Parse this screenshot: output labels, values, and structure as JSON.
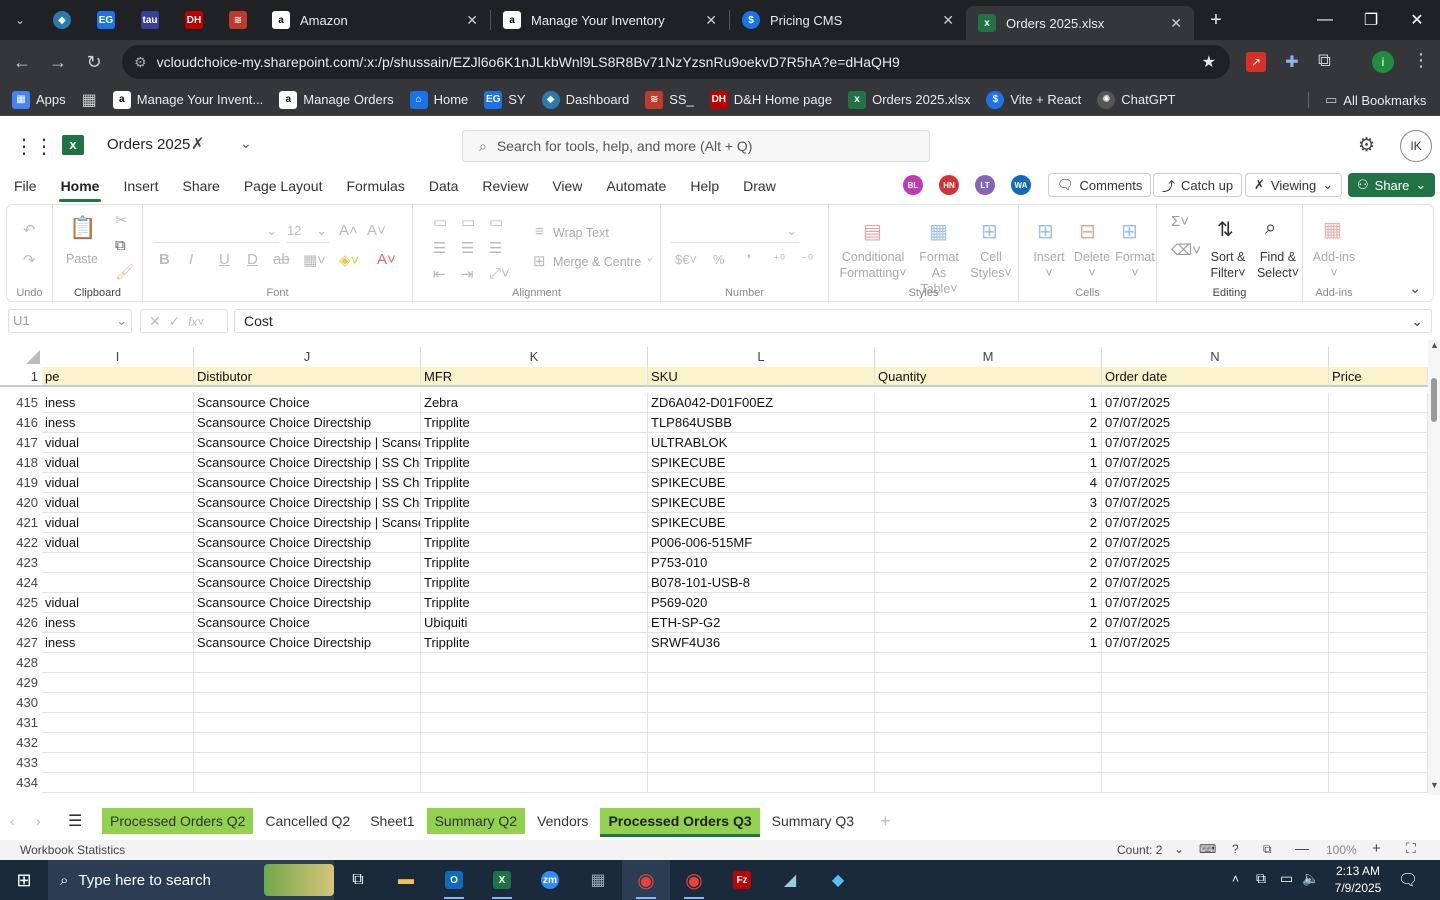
{
  "browser": {
    "tabs": [
      {
        "title": "Amazon",
        "icon": "amazon-icon",
        "active": false
      },
      {
        "title": "Manage Your Inventory",
        "icon": "amazon-icon",
        "active": false
      },
      {
        "title": "Pricing CMS",
        "icon": "dollar-icon",
        "active": false
      },
      {
        "title": "Orders 2025.xlsx",
        "icon": "excel-icon",
        "active": true
      }
    ],
    "pinned_tabs": [
      {
        "label": "EG",
        "color": "#1a73e8"
      },
      {
        "label": "tau",
        "color": "#3b3f9c"
      },
      {
        "label": "DH",
        "color": "#c00000"
      }
    ],
    "new_tab": "+",
    "url": "vcloudchoice-my.sharepoint.com/:x:/p/shussain/EZJl6o6K1nJLkbWnl9LS8R8Bv71NzYzsnRu9oekvD7R5hA?e=dHaQH9",
    "bookmarks": [
      {
        "label": "Apps"
      },
      {
        "label": "Manage Your Invent..."
      },
      {
        "label": "Manage Orders"
      },
      {
        "label": "Home"
      },
      {
        "label": "SY"
      },
      {
        "label": "Dashboard"
      },
      {
        "label": "SS_"
      },
      {
        "label": "D&H Home page"
      },
      {
        "label": "Orders 2025.xlsx"
      },
      {
        "label": "Vite + React"
      },
      {
        "label": "ChatGPT"
      }
    ],
    "all_bookmarks": "All Bookmarks",
    "profile_initial": "i"
  },
  "excel": {
    "doc_title": "Orders 2025",
    "search_placeholder": "Search for tools, help, and more (Alt + Q)",
    "user_initials": "IK",
    "menu": [
      "File",
      "Home",
      "Insert",
      "Share",
      "Page Layout",
      "Formulas",
      "Data",
      "Review",
      "View",
      "Automate",
      "Help",
      "Draw"
    ],
    "collaborators": [
      {
        "initials": "BL",
        "color": "#c239b3"
      },
      {
        "initials": "HN",
        "color": "#d13438"
      },
      {
        "initials": "LT",
        "color": "#8764b8"
      },
      {
        "initials": "WA",
        "color": "#0f6cbd"
      }
    ],
    "comments_label": "Comments",
    "catchup_label": "Catch up",
    "viewing_label": "Viewing",
    "share_label": "Share",
    "ribbon": {
      "undo_group": "Undo",
      "clipboard_group": "Clipboard",
      "paste": "Paste",
      "font_group": "Font",
      "font_size": "12",
      "alignment_group": "Alignment",
      "wrap_text": "Wrap Text",
      "merge_centre": "Merge & Centre",
      "number_group": "Number",
      "styles_group": "Styles",
      "conditional_formatting": [
        "Conditional",
        "Formatting"
      ],
      "format_as_table": [
        "Format As",
        "Table"
      ],
      "cell_styles": [
        "Cell",
        "Styles"
      ],
      "cells_group": "Cells",
      "insert": "Insert",
      "delete": "Delete",
      "format": "Format",
      "editing_group": "Editing",
      "sort_filter": [
        "Sort &",
        "Filter"
      ],
      "find_select": [
        "Find &",
        "Select"
      ],
      "addins_group": "Add-ins",
      "addins": "Add-ins"
    },
    "name_box": "U1",
    "formula": "Cost",
    "columns": [
      {
        "letter": "I",
        "header": "pe"
      },
      {
        "letter": "J",
        "header": "Distibutor"
      },
      {
        "letter": "K",
        "header": "MFR"
      },
      {
        "letter": "L",
        "header": "SKU"
      },
      {
        "letter": "M",
        "header": "Quantity"
      },
      {
        "letter": "N",
        "header": "Order date"
      },
      {
        "letter": "",
        "header": "Price"
      }
    ],
    "header_row_number": "1",
    "rows": [
      {
        "n": "415",
        "i": "iness",
        "j": "Scansource Choice",
        "k": "Zebra",
        "l": "ZD6A042-D01F00EZ",
        "m": "1",
        "date": "07/07/2025"
      },
      {
        "n": "416",
        "i": "iness",
        "j": "Scansource Choice Directship",
        "k": "Tripplite",
        "l": "TLP864USBB",
        "m": "2",
        "date": "07/07/2025"
      },
      {
        "n": "417",
        "i": "vidual",
        "j": "Scansource Choice Directship | Scansource",
        "k": "Tripplite",
        "l": "ULTRABLOK",
        "m": "1",
        "date": "07/07/2025"
      },
      {
        "n": "418",
        "i": "vidual",
        "j": "Scansource Choice Directship | SS Choice",
        "k": "Tripplite",
        "l": "SPIKECUBE",
        "m": "1",
        "date": "07/07/2025"
      },
      {
        "n": "419",
        "i": "vidual",
        "j": "Scansource Choice Directship | SS Choice",
        "k": "Tripplite",
        "l": "SPIKECUBE",
        "m": "4",
        "date": "07/07/2025"
      },
      {
        "n": "420",
        "i": "vidual",
        "j": "Scansource Choice Directship | SS Choice",
        "k": "Tripplite",
        "l": "SPIKECUBE",
        "m": "3",
        "date": "07/07/2025"
      },
      {
        "n": "421",
        "i": "vidual",
        "j": "Scansource Choice Directship | Scansource",
        "k": "Tripplite",
        "l": "SPIKECUBE",
        "m": "2",
        "date": "07/07/2025"
      },
      {
        "n": "422",
        "i": "vidual",
        "j": "Scansource Choice Directship",
        "k": "Tripplite",
        "l": "P006-006-515MF",
        "m": "2",
        "date": "07/07/2025"
      },
      {
        "n": "423",
        "i": "",
        "j": "Scansource Choice Directship",
        "k": "Tripplite",
        "l": "P753-010",
        "m": "2",
        "date": "07/07/2025"
      },
      {
        "n": "424",
        "i": "",
        "j": "Scansource Choice Directship",
        "k": "Tripplite",
        "l": "B078-101-USB-8",
        "m": "2",
        "date": "07/07/2025"
      },
      {
        "n": "425",
        "i": "vidual",
        "j": "Scansource Choice Directship",
        "k": "Tripplite",
        "l": "P569-020",
        "m": "1",
        "date": "07/07/2025"
      },
      {
        "n": "426",
        "i": "iness",
        "j": "Scansource Choice",
        "k": "Ubiquiti",
        "l": "ETH-SP-G2",
        "m": "2",
        "date": "07/07/2025"
      },
      {
        "n": "427",
        "i": "iness",
        "j": "Scansource Choice Directship",
        "k": "Tripplite",
        "l": "SRWF4U36",
        "m": "1",
        "date": "07/07/2025"
      },
      {
        "n": "428",
        "i": "",
        "j": "",
        "k": "",
        "l": "",
        "m": "",
        "date": ""
      },
      {
        "n": "429",
        "i": "",
        "j": "",
        "k": "",
        "l": "",
        "m": "",
        "date": ""
      },
      {
        "n": "430",
        "i": "",
        "j": "",
        "k": "",
        "l": "",
        "m": "",
        "date": ""
      },
      {
        "n": "431",
        "i": "",
        "j": "",
        "k": "",
        "l": "",
        "m": "",
        "date": ""
      },
      {
        "n": "432",
        "i": "",
        "j": "",
        "k": "",
        "l": "",
        "m": "",
        "date": ""
      },
      {
        "n": "433",
        "i": "",
        "j": "",
        "k": "",
        "l": "",
        "m": "",
        "date": ""
      },
      {
        "n": "434",
        "i": "",
        "j": "",
        "k": "",
        "l": "",
        "m": "",
        "date": ""
      }
    ],
    "sheets": [
      {
        "name": "Processed Orders Q2",
        "green": true,
        "selected": false
      },
      {
        "name": "Cancelled Q2",
        "green": false,
        "selected": false
      },
      {
        "name": "Sheet1",
        "green": false,
        "selected": false
      },
      {
        "name": "Summary Q2",
        "green": true,
        "selected": false
      },
      {
        "name": "Vendors",
        "green": false,
        "selected": false
      },
      {
        "name": "Processed Orders Q3",
        "green": true,
        "selected": true
      },
      {
        "name": "Summary Q3",
        "green": false,
        "selected": false
      }
    ],
    "add_sheet": "+",
    "status_left": "Workbook Statistics",
    "status_count": "Count: 2",
    "zoom": "100%"
  },
  "taskbar": {
    "search_placeholder": "Type here to search",
    "time": "2:13 AM",
    "date": "7/9/2025"
  },
  "colors": {
    "excel_green": "#217346",
    "sheet_tab_green": "#92d050",
    "header_fill": "#fbf3cc",
    "browser_dark": "#202124",
    "taskbar": "#1b2a3b"
  }
}
